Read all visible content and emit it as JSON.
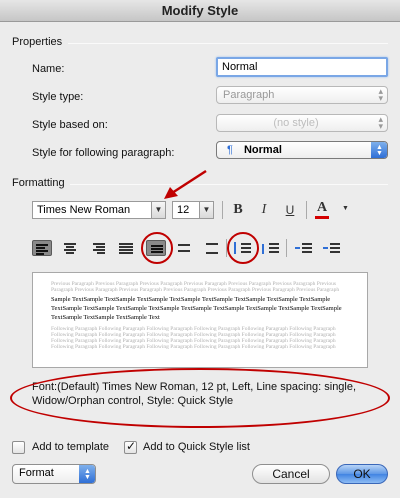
{
  "window": {
    "title": "Modify Style"
  },
  "properties": {
    "header": "Properties",
    "name_label": "Name:",
    "name_value": "Normal",
    "style_type_label": "Style type:",
    "style_type_value": "Paragraph",
    "based_on_label": "Style based on:",
    "based_on_value": "(no style)",
    "following_label": "Style for following paragraph:",
    "following_value": "Normal",
    "following_icon": "pilcrow-icon"
  },
  "formatting": {
    "header": "Formatting",
    "font_name": "Times New Roman",
    "font_size": "12",
    "bold": "B",
    "italic": "I",
    "underline": "U",
    "font_color_letter": "A",
    "font_color": "#d40000",
    "alignment_selected": "left",
    "line_spacing_selected": "single"
  },
  "preview": {
    "previous_text": "Previous Paragraph Previous Paragraph Previous Paragraph Previous Paragraph Previous Paragraph Previous Paragraph Previous Paragraph Previous Paragraph Previous Paragraph Previous Paragraph Previous Paragraph Previous Paragraph Previous Paragraph",
    "sample_text": "Sample TextSample TextSample TextSample TextSample TextSample TextSample TextSample TextSample TextSample TextSample TextSample TextSample TextSample TextSample TextSample TextSample TextSample TextSample TextSample TextSample Text",
    "following_text": "Following Paragraph Following Paragraph Following Paragraph Following Paragraph Following Paragraph Following Paragraph Following Paragraph Following Paragraph Following Paragraph Following Paragraph Following Paragraph Following Paragraph Following Paragraph Following Paragraph Following Paragraph Following Paragraph Following Paragraph Following Paragraph Following Paragraph Following Paragraph Following Paragraph Following Paragraph Following Paragraph Following Paragraph"
  },
  "description": "Font:(Default) Times New Roman, 12 pt, Left, Line spacing:  single, Widow/Orphan control, Style: Quick Style",
  "options": {
    "add_to_template_label": "Add to template",
    "add_to_template_checked": false,
    "add_to_quick_style_label": "Add to Quick Style list",
    "add_to_quick_style_checked": true
  },
  "footer": {
    "format_label": "Format",
    "cancel_label": "Cancel",
    "ok_label": "OK"
  },
  "annotation": {
    "color": "#c00000"
  }
}
